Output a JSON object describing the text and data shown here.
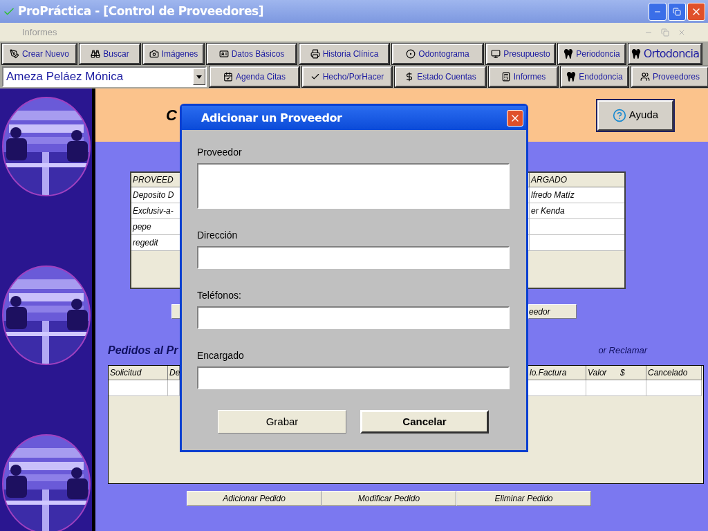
{
  "window": {
    "title": "ProPráctica - [Control de Proveedores]"
  },
  "menu": [
    {
      "label": "Informes",
      "disabled": true
    }
  ],
  "toolbar": {
    "row_1": [
      "Crear Nuevo",
      "Buscar",
      "Imágenes",
      "Datos Básicos",
      "Historia Clínica",
      "Odontograma",
      "Presupuesto",
      "Periodoncia",
      "Ortodoncia"
    ],
    "patient_select": {
      "value": "Ameza Peláez Mónica"
    },
    "row_2": [
      "Agenda Citas",
      "Hecho/PorHacer",
      "Estado Cuentas",
      "Informes",
      "Endodoncia",
      "Proveedores"
    ]
  },
  "header": {
    "title": "C",
    "help_button": "Ayuda"
  },
  "suppliers_table": {
    "columns": [
      "PROVEED",
      "ARGADO"
    ],
    "rows": [
      {
        "column_1": "Deposito D",
        "column_2": "lfredo Matíz"
      },
      {
        "column_1": "Exclusiv-a-",
        "column_2": "er Kenda"
      },
      {
        "column_1": "pepe"
      },
      {
        "column_1": "regedit"
      }
    ]
  },
  "supplier_buttons": [
    "eedor"
  ],
  "orders": {
    "title": "Pedidos al Pr",
    "note": "or Reclamar",
    "columns": [
      "Solicitud",
      "De",
      "lo.Factura",
      "Valor $",
      "Cancelado"
    ]
  },
  "order_buttons": [
    "Adicionar Pedido",
    "Modificar Pedido",
    "Eliminar Pedido"
  ],
  "dialog": {
    "title": "Adicionar un Proveedor",
    "fields": [
      {
        "label": "Proveedor",
        "kind": "multiline"
      },
      {
        "label": "Dirección",
        "kind": "line"
      },
      {
        "label": "Teléfonos:",
        "kind": "line"
      },
      {
        "label": "Encargado",
        "kind": "line"
      }
    ],
    "buttons": [
      {
        "label": "Grabar",
        "default": false
      },
      {
        "label": "Cancelar",
        "default": true
      }
    ]
  }
}
